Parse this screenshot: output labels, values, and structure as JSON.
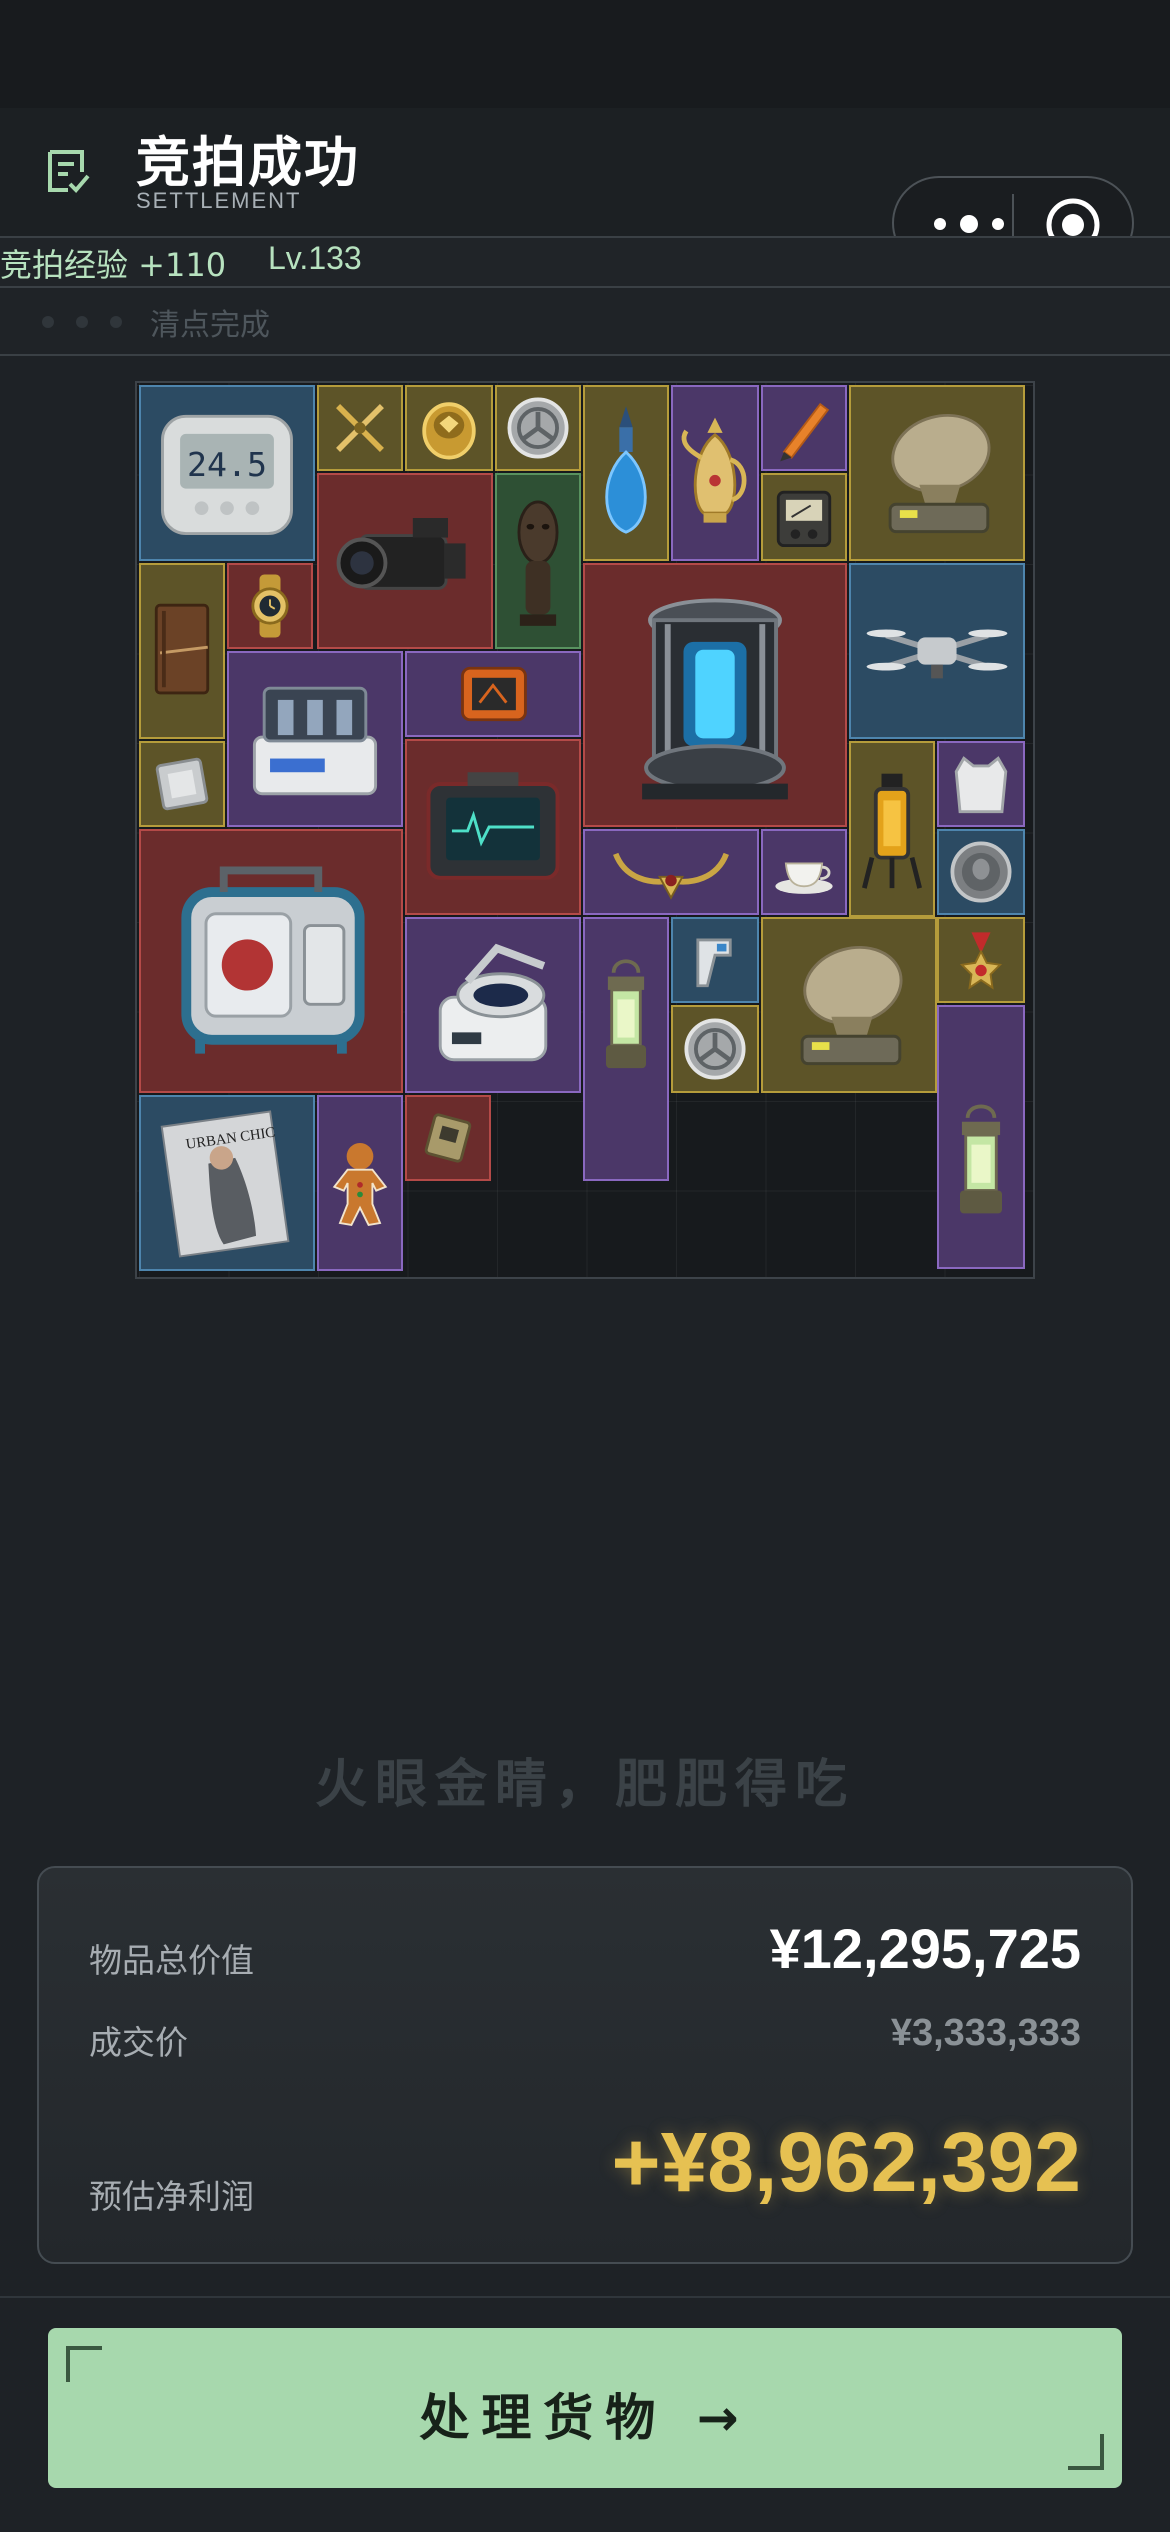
{
  "header": {
    "title": "竞拍成功",
    "subtitle": "SETTLEMENT",
    "icon": "document-check-icon"
  },
  "mini_program_capsule": {
    "menu_icon": "more-dots-icon",
    "close_icon": "target-circle-icon"
  },
  "progress": {
    "xp_text": "竞拍经验 +110",
    "level_text": "Lv.133",
    "status_text": "清点完成"
  },
  "inventory": {
    "items": [
      {
        "id": "thermometer",
        "rarity": "blue",
        "icon": "digital-thermometer-icon",
        "display": "24.5"
      },
      {
        "id": "crossed-pens",
        "rarity": "gold",
        "icon": "crossed-pens-icon"
      },
      {
        "id": "gold-ring",
        "rarity": "gold",
        "icon": "gold-ring-icon"
      },
      {
        "id": "emblem-1",
        "rarity": "gold",
        "icon": "emblem-badge-icon"
      },
      {
        "id": "perfume",
        "rarity": "gold",
        "icon": "perfume-bottle-icon"
      },
      {
        "id": "teapot",
        "rarity": "purple",
        "icon": "golden-ewer-icon"
      },
      {
        "id": "pen",
        "rarity": "purple",
        "icon": "fountain-pen-icon"
      },
      {
        "id": "radar-1",
        "rarity": "gold",
        "icon": "radar-dish-icon"
      },
      {
        "id": "camcorder",
        "rarity": "red",
        "icon": "camcorder-icon"
      },
      {
        "id": "statue",
        "rarity": "green",
        "icon": "tribal-statue-icon"
      },
      {
        "id": "meter",
        "rarity": "gold",
        "icon": "analog-meter-icon"
      },
      {
        "id": "journal",
        "rarity": "gold",
        "icon": "leather-journal-icon"
      },
      {
        "id": "watch",
        "rarity": "red",
        "icon": "gold-watch-icon"
      },
      {
        "id": "reactor",
        "rarity": "red",
        "icon": "energy-reactor-icon"
      },
      {
        "id": "drone",
        "rarity": "blue",
        "icon": "drone-icon"
      },
      {
        "id": "lab-device",
        "rarity": "purple",
        "icon": "lab-apparatus-icon"
      },
      {
        "id": "orange-case",
        "rarity": "purple",
        "icon": "rugged-case-icon"
      },
      {
        "id": "cpu",
        "rarity": "gold",
        "icon": "cpu-chip-icon"
      },
      {
        "id": "monitor",
        "rarity": "red",
        "icon": "medical-monitor-icon"
      },
      {
        "id": "fuel-canister",
        "rarity": "gold",
        "icon": "fuel-canister-icon"
      },
      {
        "id": "vest",
        "rarity": "purple",
        "icon": "body-armor-icon"
      },
      {
        "id": "generator",
        "rarity": "red",
        "icon": "generator-engine-icon"
      },
      {
        "id": "horns",
        "rarity": "purple",
        "icon": "horn-ornament-icon"
      },
      {
        "id": "teacup",
        "rarity": "purple",
        "icon": "teacup-icon"
      },
      {
        "id": "coin",
        "rarity": "blue",
        "icon": "silver-coin-icon"
      },
      {
        "id": "centrifuge",
        "rarity": "purple",
        "icon": "centrifuge-icon"
      },
      {
        "id": "lantern-1",
        "rarity": "purple",
        "icon": "lantern-icon"
      },
      {
        "id": "ir-thermometer",
        "rarity": "blue",
        "icon": "ir-thermometer-icon"
      },
      {
        "id": "radar-2",
        "rarity": "gold",
        "icon": "radar-dish-icon"
      },
      {
        "id": "medal",
        "rarity": "gold",
        "icon": "medal-icon"
      },
      {
        "id": "emblem-2",
        "rarity": "gold",
        "icon": "emblem-badge-icon"
      },
      {
        "id": "magazine",
        "rarity": "blue",
        "icon": "magazine-icon",
        "display": "URBAN CHIC"
      },
      {
        "id": "gingerbread",
        "rarity": "purple",
        "icon": "gingerbread-man-icon"
      },
      {
        "id": "module",
        "rarity": "red",
        "icon": "circuit-module-icon"
      },
      {
        "id": "lantern-2",
        "rarity": "purple",
        "icon": "lantern-icon"
      }
    ]
  },
  "slogan": "火眼金睛，肥肥得吃",
  "summary": {
    "total_label": "物品总价值",
    "total_value": "¥12,295,725",
    "deal_label": "成交价",
    "deal_value": "¥3,333,333",
    "profit_label": "预估净利润",
    "profit_value": "+¥8,962,392"
  },
  "action": {
    "button_label": "处理货物 →"
  },
  "colors": {
    "accent_green": "#a7d8ad",
    "profit_gold": "#e6c152",
    "rarity_blue": "#2c4b63",
    "rarity_gold": "#5d5428",
    "rarity_red": "#6b2c2c",
    "rarity_purple": "#4b3768",
    "rarity_green": "#2e5034"
  }
}
